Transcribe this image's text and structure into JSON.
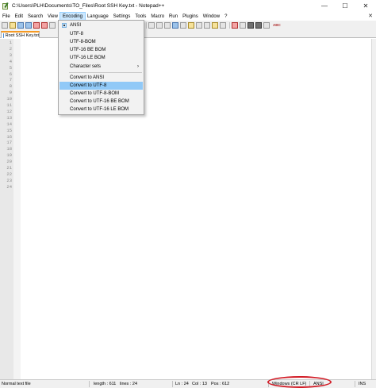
{
  "window": {
    "title": "C:\\Users\\PLH\\Documents\\TO_Files\\Root SSH Key.txt - Notepad++",
    "minimize": "—",
    "maximize": "☐",
    "close": "✕"
  },
  "menubar": {
    "items": [
      "File",
      "Edit",
      "Search",
      "View",
      "Encoding",
      "Language",
      "Settings",
      "Tools",
      "Macro",
      "Run",
      "Plugins",
      "Window",
      "?"
    ],
    "close_glyph": "✕"
  },
  "toolbar": {
    "spell_label": "ABC"
  },
  "tab": {
    "label": "Root SSH Key.txt"
  },
  "editor": {
    "line_numbers": [
      "1",
      "2",
      "3",
      "4",
      "5",
      "6",
      "7",
      "8",
      "9",
      "10",
      "11",
      "12",
      "13",
      "14",
      "15",
      "16",
      "17",
      "18",
      "19",
      "20",
      "21",
      "22",
      "23",
      "24"
    ]
  },
  "encoding_menu": {
    "items": [
      {
        "label": "ANSI",
        "checked": true
      },
      {
        "label": "UTF-8"
      },
      {
        "label": "UTF-8-BOM"
      },
      {
        "label": "UTF-16 BE BOM"
      },
      {
        "label": "UTF-16 LE BOM"
      },
      {
        "label": "Character sets",
        "submenu": "›"
      },
      {
        "label": "Convert to ANSI"
      },
      {
        "label": "Convert to UTF-8",
        "highlighted": true
      },
      {
        "label": "Convert to UTF-8-BOM"
      },
      {
        "label": "Convert to UTF-16 BE BOM"
      },
      {
        "label": "Convert to UTF-16 LE BOM"
      }
    ]
  },
  "statusbar": {
    "file_type": "Normal text file",
    "length": "length : 611",
    "lines": "lines : 24",
    "ln": "Ln : 24",
    "col": "Col : 13",
    "pos": "Pos : 612",
    "eol": "Windows (CR LF)",
    "encoding": "ANSI",
    "mode": "INS"
  },
  "colors": {
    "accent_tab": "#f59a23",
    "menu_highlight": "#91c9f7",
    "annotation": "#d21e28"
  }
}
